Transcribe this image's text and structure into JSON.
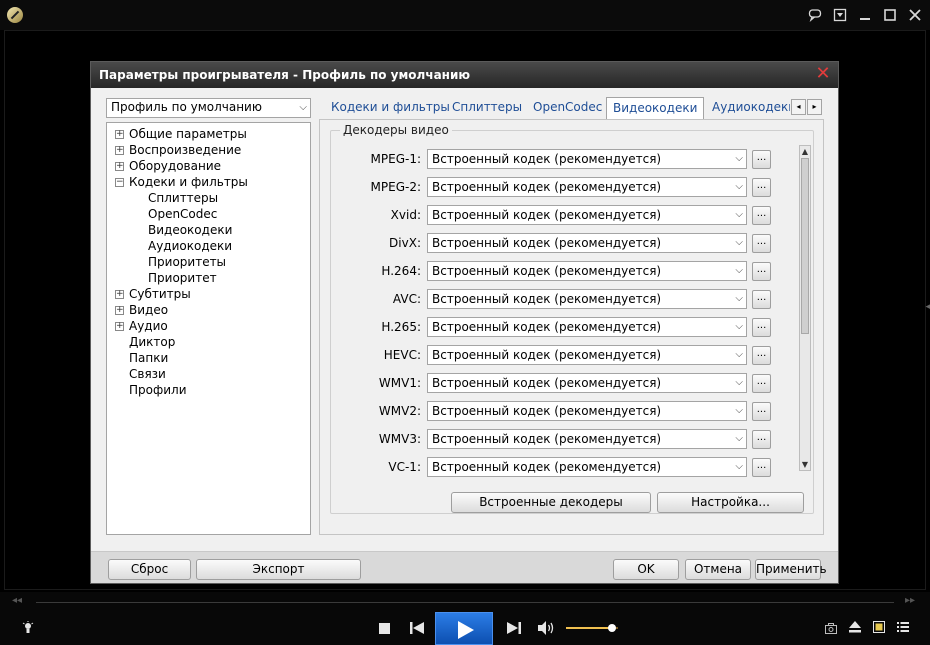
{
  "dialog": {
    "title": "Параметры проигрывателя - Профиль по умолчанию",
    "profile_select": "Профиль по умолчанию"
  },
  "tree": [
    {
      "label": "Общие параметры",
      "expander": "+"
    },
    {
      "label": "Воспроизведение",
      "expander": "+"
    },
    {
      "label": "Оборудование",
      "expander": "+"
    },
    {
      "label": "Кодеки и фильтры",
      "expander": "−"
    },
    {
      "label": "Сплиттеры",
      "expander": ""
    },
    {
      "label": "OpenCodec",
      "expander": ""
    },
    {
      "label": "Видеокодеки",
      "expander": ""
    },
    {
      "label": "Аудиокодеки",
      "expander": ""
    },
    {
      "label": "Приоритеты",
      "expander": ""
    },
    {
      "label": "Приоритет",
      "expander": ""
    },
    {
      "label": "Субтитры",
      "expander": "+"
    },
    {
      "label": "Видео",
      "expander": "+"
    },
    {
      "label": "Аудио",
      "expander": "+"
    },
    {
      "label": "Диктор",
      "expander": ""
    },
    {
      "label": "Папки",
      "expander": ""
    },
    {
      "label": "Связи",
      "expander": ""
    },
    {
      "label": "Профили",
      "expander": ""
    }
  ],
  "tabs": [
    {
      "label": "Кодеки и фильтры"
    },
    {
      "label": "Сплиттеры"
    },
    {
      "label": "OpenCodec"
    },
    {
      "label": "Видеокодеки",
      "active": true
    },
    {
      "label": "Аудиокодеки"
    }
  ],
  "decoders": {
    "group_label": "Декодеры видео",
    "rows": [
      {
        "label": "MPEG-1:",
        "value": "Встроенный кодек (рекомендуется)"
      },
      {
        "label": "MPEG-2:",
        "value": "Встроенный кодек (рекомендуется)"
      },
      {
        "label": "Xvid:",
        "value": "Встроенный кодек (рекомендуется)"
      },
      {
        "label": "DivX:",
        "value": "Встроенный кодек (рекомендуется)"
      },
      {
        "label": "H.264:",
        "value": "Встроенный кодек (рекомендуется)"
      },
      {
        "label": "AVC:",
        "value": "Встроенный кодек (рекомендуется)"
      },
      {
        "label": "H.265:",
        "value": "Встроенный кодек (рекомендуется)"
      },
      {
        "label": "HEVC:",
        "value": "Встроенный кодек (рекомендуется)"
      },
      {
        "label": "WMV1:",
        "value": "Встроенный кодек (рекомендуется)"
      },
      {
        "label": "WMV2:",
        "value": "Встроенный кодек (рекомендуется)"
      },
      {
        "label": "WMV3:",
        "value": "Встроенный кодек (рекомендуется)"
      },
      {
        "label": "VC-1:",
        "value": "Встроенный кодек (рекомендуется)"
      }
    ],
    "dots_label": "...",
    "builtin_button": "Встроенные декодеры",
    "settings_button": "Настройка..."
  },
  "bottom_buttons": {
    "reset": "Сброс",
    "export": "Экспорт",
    "ok": "OK",
    "cancel": "Отмена",
    "apply": "Применить"
  },
  "player": {
    "volume_level": 0.88
  },
  "colors": {
    "play_button": "#1a63cc",
    "tab_text": "#1f4e96",
    "close_icon": "#e23b3b"
  }
}
